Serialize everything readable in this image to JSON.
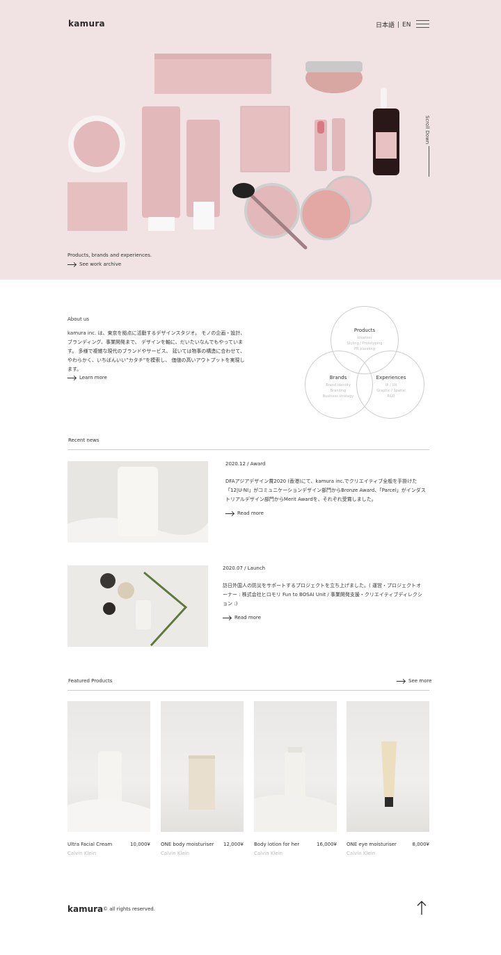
{
  "header": {
    "logo": "kamura",
    "lang_ja": "日本語",
    "lang_en": "EN",
    "scroll_label": "Scroll Down"
  },
  "hero": {
    "tagline": "Products, brands and experiences.",
    "link_label": "See work archive"
  },
  "about": {
    "title": "About us",
    "text": "kamura inc. は、東京を拠点に活動するデザインスタジオ。 モノの企画・設計、ブランディング、事業開発まで、 デザインを軸に、だいたいなんでもやっています。 多様で複雑な現代のブランドやサービス、 延いては物事の構造に合わせて、 やわらかく、いちばんいい”カタチ”を模索し、 価値の高いアウトプットを実現します。",
    "link_label": "Learn more",
    "venn": {
      "products": {
        "title": "Products",
        "items": [
          "Ideation",
          "Styling / Prototyping",
          "PR planning"
        ]
      },
      "brands": {
        "title": "Brands",
        "items": [
          "Brand identity",
          "Branding",
          "Business strategy"
        ]
      },
      "experiences": {
        "title": "Experiences",
        "items": [
          "UI / UX",
          "Graphic / Spatial",
          "R&D"
        ]
      }
    }
  },
  "news": {
    "title": "Recent news",
    "items": [
      {
        "date": "2020.12 / Award",
        "text": "DFAアジアデザイン賞2020 (香港)にて、kamura inc.でクリエイティブ全般を手掛けた「12|U-NI」がコミュニケーションデザイン部門からBronze Award、「Parcel」がインダストリアルデザイン部門からMerit Awardを、それぞれ受賞しました。",
        "link": "Read more"
      },
      {
        "date": "2020.07 / Launch",
        "text": "訪日外国人の防災をサポートするプロジェクトを立ち上げました。( 運営・プロジェクトオーナー : 株式会社ヒロモリ Fun to BOSAI Unit / 事業開発支援・クリエイティブディレクション :)",
        "link": "Read more"
      }
    ]
  },
  "featured": {
    "title": "Featured Products",
    "see_more": "See more",
    "products": [
      {
        "name": "Ultra Facial Cream",
        "price": "10,000¥",
        "brand": "Calvin Klein"
      },
      {
        "name": "ONE body moisturiser",
        "price": "12,000¥",
        "brand": "Calvin Klein"
      },
      {
        "name": "Body lotion for her",
        "price": "16,000¥",
        "brand": "Calvin Klein"
      },
      {
        "name": "ONE eye moisturiser",
        "price": "8,000¥",
        "brand": "Calvin Klein"
      }
    ]
  },
  "footer": {
    "logo": "kamura",
    "copyright": "© all rights reserved."
  },
  "colors": {
    "hero_bg": "#f1e3e4",
    "product_pink": "#e2b8ba",
    "text": "#333333",
    "muted": "#bbbbbb"
  }
}
